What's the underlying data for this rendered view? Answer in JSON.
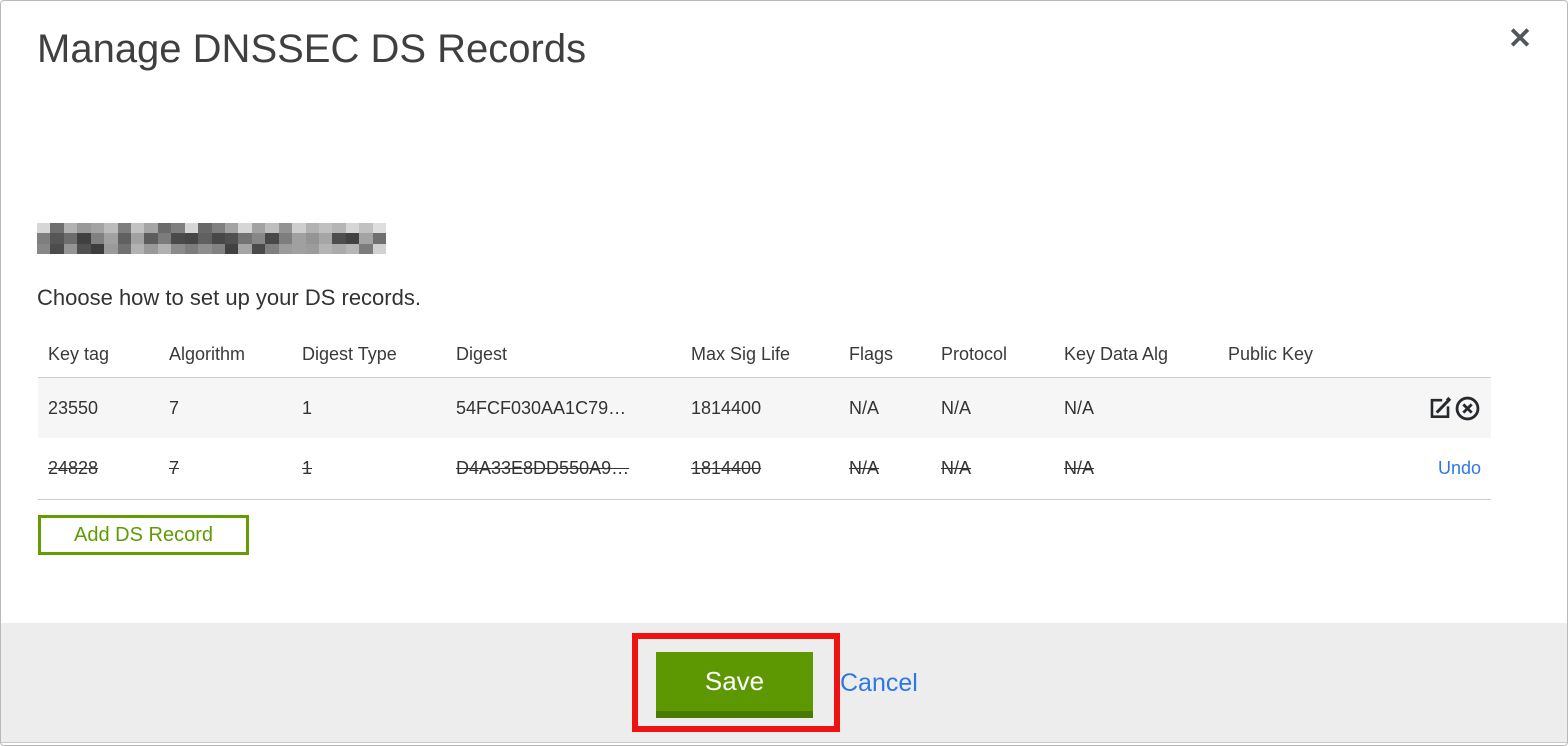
{
  "modal": {
    "title": "Manage DNSSEC DS Records",
    "close_glyph": "✕",
    "domain_redacted": true,
    "instruction": "Choose how to set up your DS records.",
    "table": {
      "headers": [
        "Key tag",
        "Algorithm",
        "Digest Type",
        "Digest",
        "Max Sig Life",
        "Flags",
        "Protocol",
        "Key Data Alg",
        "Public Key"
      ],
      "rows": [
        {
          "cells": [
            "23550",
            "7",
            "1",
            "54FCF030AA1C79…",
            "1814400",
            "N/A",
            "N/A",
            "N/A",
            ""
          ],
          "deleted": false,
          "action_icons": [
            "edit-icon",
            "remove-circle-icon"
          ]
        },
        {
          "cells": [
            "24828",
            "7",
            "1",
            "D4A33E8DD550A9…",
            "1814400",
            "N/A",
            "N/A",
            "N/A",
            ""
          ],
          "deleted": true,
          "undo_label": "Undo"
        }
      ]
    },
    "add_record_label": "Add DS Record",
    "footer": {
      "save_label": "Save",
      "cancel_label": "Cancel"
    },
    "colors": {
      "accent_green": "#5d9803",
      "accent_green_dark": "#4b7a02",
      "outline_green": "#649c04",
      "link_blue": "#2e77e5",
      "annotation_red": "#ed1313",
      "row_highlight": "#f6f6f6",
      "footer_bg": "#ededed"
    }
  }
}
